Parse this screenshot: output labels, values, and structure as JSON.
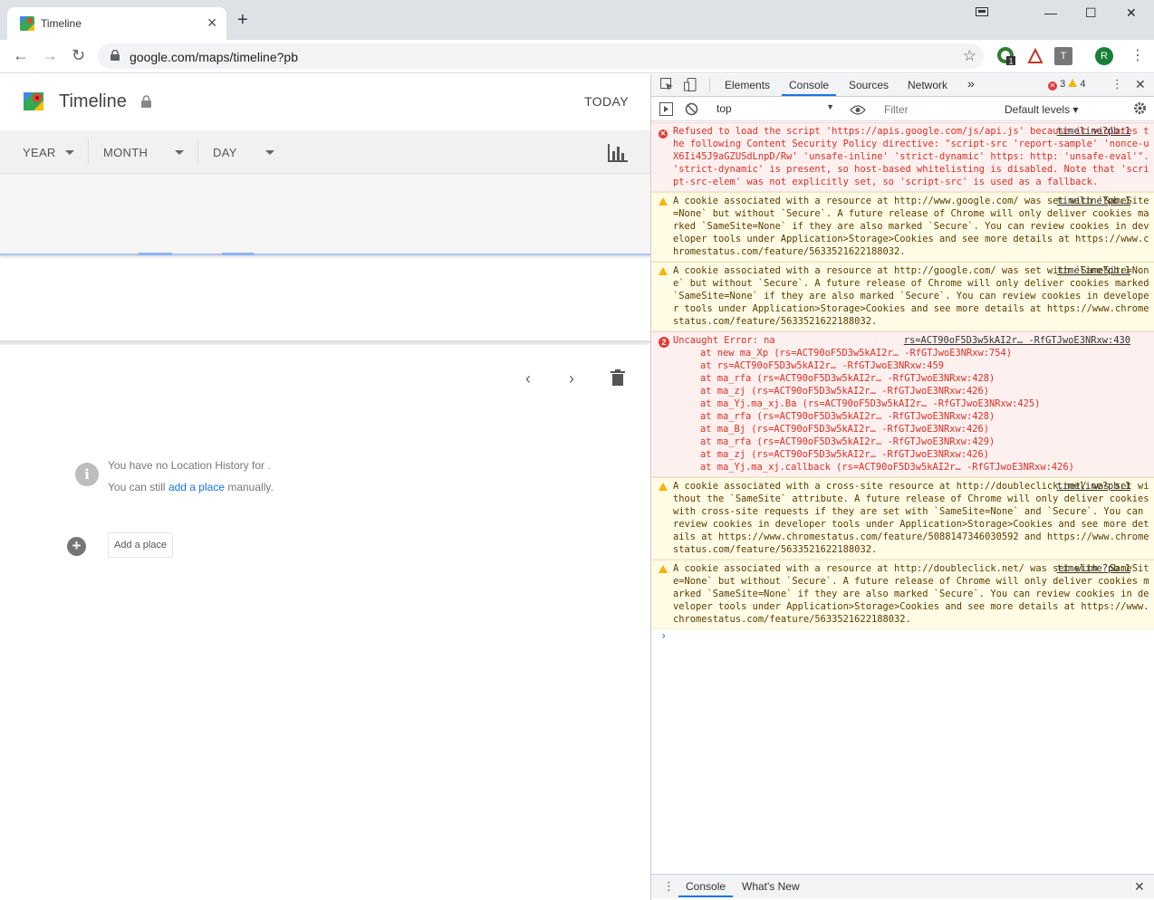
{
  "browser": {
    "tab_title": "Timeline",
    "tab_close": "✕",
    "new_tab": "+",
    "url": "google.com/maps/timeline?pb",
    "minimize": "—",
    "maximize": "☐",
    "close": "✕",
    "avatar_letter": "R",
    "ext_badge": "1",
    "ext_t": "T"
  },
  "timeline": {
    "title": "Timeline",
    "today": "TODAY",
    "filters": [
      "YEAR",
      "MONTH",
      "DAY"
    ],
    "no_history": "You have no Location History for .",
    "can_still_prefix": "You can still ",
    "add_place_link": "add a place",
    "can_still_suffix": " manually.",
    "add_place_button": "Add a place",
    "prev": "‹",
    "next": "›"
  },
  "devtools": {
    "tabs": [
      "Elements",
      "Console",
      "Sources",
      "Network"
    ],
    "more": "»",
    "errors": "3",
    "warnings": "4",
    "context": "top",
    "filter_placeholder": "Filter",
    "levels": "Default levels ▾",
    "drawer_tabs": [
      "Console",
      "What's New"
    ],
    "messages": [
      {
        "level": "error",
        "source": "timeline?pb:1",
        "text": "Refused to load the script 'https://apis.google.com/js/api.js' because it violates the following Content Security Policy directive: \"script-src 'report-sample' 'nonce-uX6Ii45J9aGZUSdLnpD/Rw' 'unsafe-inline' 'strict-dynamic' https: http: 'unsafe-eval'\". 'strict-dynamic' is present, so host-based whitelisting is disabled. Note that 'script-src-elem' was not explicitly set, so 'script-src' is used as a fallback."
      },
      {
        "level": "warn",
        "source": "timeline?pb:1",
        "text": "A cookie associated with a resource at http://www.google.com/ was set with `SameSite=None` but without `Secure`. A future release of Chrome will only deliver cookies marked `SameSite=None` if they are also marked `Secure`. You can review cookies in developer tools under Application>Storage>Cookies and see more details at https://www.chromestatus.com/feature/5633521622188032."
      },
      {
        "level": "warn",
        "source": "timeline?pb:1",
        "text": "A cookie associated with a resource at http://google.com/ was set with `SameSite=None` but without `Secure`. A future release of Chrome will only deliver cookies marked `SameSite=None` if they are also marked `Secure`. You can review cookies in developer tools under Application>Storage>Cookies and see more details at https://www.chromestatus.com/feature/5633521622188032."
      },
      {
        "level": "error",
        "count": "2",
        "source": "rs=ACT90oF5D3w5kAI2r… -RfGTJwoE3NRxw:430",
        "text": "Uncaught Error: na",
        "stack": [
          "at new ma_Xp (rs=ACT90oF5D3w5kAI2r… -RfGTJwoE3NRxw:754)",
          "at rs=ACT90oF5D3w5kAI2r… -RfGTJwoE3NRxw:459",
          "at ma_rfa (rs=ACT90oF5D3w5kAI2r… -RfGTJwoE3NRxw:428)",
          "at ma_zj (rs=ACT90oF5D3w5kAI2r… -RfGTJwoE3NRxw:426)",
          "at ma_Yj.ma_xj.Ba (rs=ACT90oF5D3w5kAI2r… -RfGTJwoE3NRxw:425)",
          "at ma_rfa (rs=ACT90oF5D3w5kAI2r… -RfGTJwoE3NRxw:428)",
          "at ma_Bj (rs=ACT90oF5D3w5kAI2r… -RfGTJwoE3NRxw:426)",
          "at ma_rfa (rs=ACT90oF5D3w5kAI2r… -RfGTJwoE3NRxw:429)",
          "at ma_zj (rs=ACT90oF5D3w5kAI2r… -RfGTJwoE3NRxw:426)",
          "at ma_Yj.ma_xj.callback (rs=ACT90oF5D3w5kAI2r… -RfGTJwoE3NRxw:426)"
        ]
      },
      {
        "level": "warn",
        "source": "timeline?pb:1",
        "text": "A cookie associated with a cross-site resource at http://doubleclick.net/ was set without the `SameSite` attribute. A future release of Chrome will only deliver cookies with cross-site requests if they are set with `SameSite=None` and `Secure`. You can review cookies in developer tools under Application>Storage>Cookies and see more details at https://www.chromestatus.com/feature/5088147346030592 and https://www.chromestatus.com/feature/5633521622188032."
      },
      {
        "level": "warn",
        "source": "timeline?pb:1",
        "text": "A cookie associated with a resource at http://doubleclick.net/ was set with `SameSite=None` but without `Secure`. A future release of Chrome will only deliver cookies marked `SameSite=None` if they are also marked `Secure`. You can review cookies in developer tools under Application>Storage>Cookies and see more details at https://www.chromestatus.com/feature/5633521622188032."
      }
    ],
    "prompt": "›"
  },
  "colors": {
    "accent": "#1a73e8",
    "error_bg": "#fef0ef",
    "error_text": "#d93025",
    "warn_bg": "#fffbe5",
    "warn_icon": "#f4b400"
  }
}
